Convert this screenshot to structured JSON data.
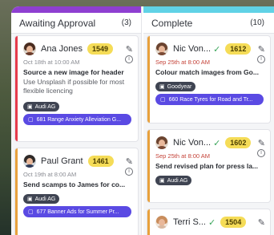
{
  "columns": [
    {
      "title": "Awaiting Approval",
      "count": "(3)",
      "cards": [
        {
          "name": "Ana Jones",
          "points": "1549",
          "date": "Oct 18th at 10:00 AM",
          "title": "Source a new image for header",
          "desc": "Use Unsplash if possible for most flexible licencing",
          "client": "Audi AG",
          "project": "681  Range Anxiety Alleviation G..."
        },
        {
          "name": "Paul Grant",
          "points": "1461",
          "date": "Oct 19th at 8:00 AM",
          "title": "Send scamps to James for co...",
          "client": "Audi AG",
          "project": "677  Banner Ads for Summer Pr..."
        }
      ]
    },
    {
      "title": "Complete",
      "count": "(10)",
      "cards": [
        {
          "name": "Nic Von...",
          "points": "1612",
          "date": "Sep 25th at 8:00 AM",
          "title": "Colour match images from Go...",
          "client": "Goodyear",
          "project": "660  Race Tyres for Road and Tr..."
        },
        {
          "name": "Nic Von...",
          "points": "1602",
          "date": "Sep 25th at 8:00 AM",
          "title": "Send revised plan for press la...",
          "client": "Audi AG"
        },
        {
          "name": "Terri S...",
          "points": "1504"
        }
      ]
    }
  ],
  "colors": {
    "awaiting_accent": "#e63b4c",
    "paul_accent": "#e8a13c",
    "complete_accent": "#e8a13c",
    "points_pill": "#f5dc57",
    "project_tag": "#5a4ae3",
    "client_tag": "#3f4452"
  },
  "icons": {
    "edit": "pencil-icon",
    "info": "info-icon",
    "client": "building-icon",
    "project": "folder-icon",
    "approved": "check-icon"
  }
}
